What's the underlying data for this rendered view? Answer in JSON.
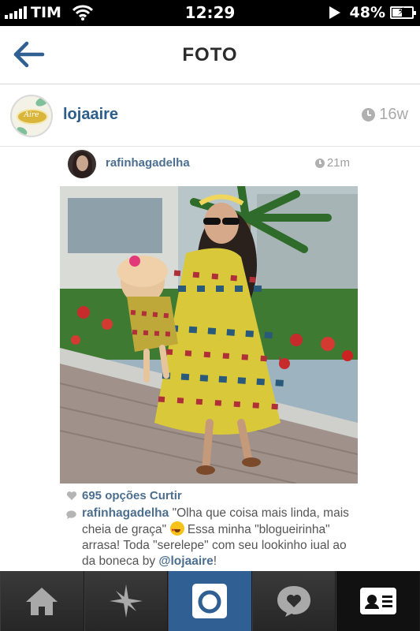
{
  "status_bar": {
    "carrier": "TIM",
    "time": "12:29",
    "battery_percent": "48%",
    "signal_bars": 5,
    "battery_level": 0.48
  },
  "header": {
    "title": "FOTO",
    "back_icon": "arrow-left-icon"
  },
  "post": {
    "username": "lojaaire",
    "avatar_word": "Aire",
    "time": "16w"
  },
  "shared": {
    "username": "rafinhagadelha",
    "time": "21m",
    "likes": "695 opções Curtir",
    "comment": {
      "username": "rafinhagadelha",
      "text_before_emoji": "\"Olha que coisa mais linda, mais cheia de graça\"",
      "text_after_emoji": "Essa minha \"blogueirinha\" arrasa! Toda \"serelepe\" com seu lookinho iual ao da boneca by",
      "mention": "@lojaaire",
      "suffix": "!"
    }
  },
  "tabs": [
    {
      "icon": "home-icon"
    },
    {
      "icon": "explore-icon"
    },
    {
      "icon": "camera-icon"
    },
    {
      "icon": "activity-icon"
    },
    {
      "icon": "profile-icon"
    }
  ],
  "colors": {
    "link": "#2d5d8a",
    "active_tab": "#2f5f93",
    "tab_bar": "#2b2b2b"
  }
}
